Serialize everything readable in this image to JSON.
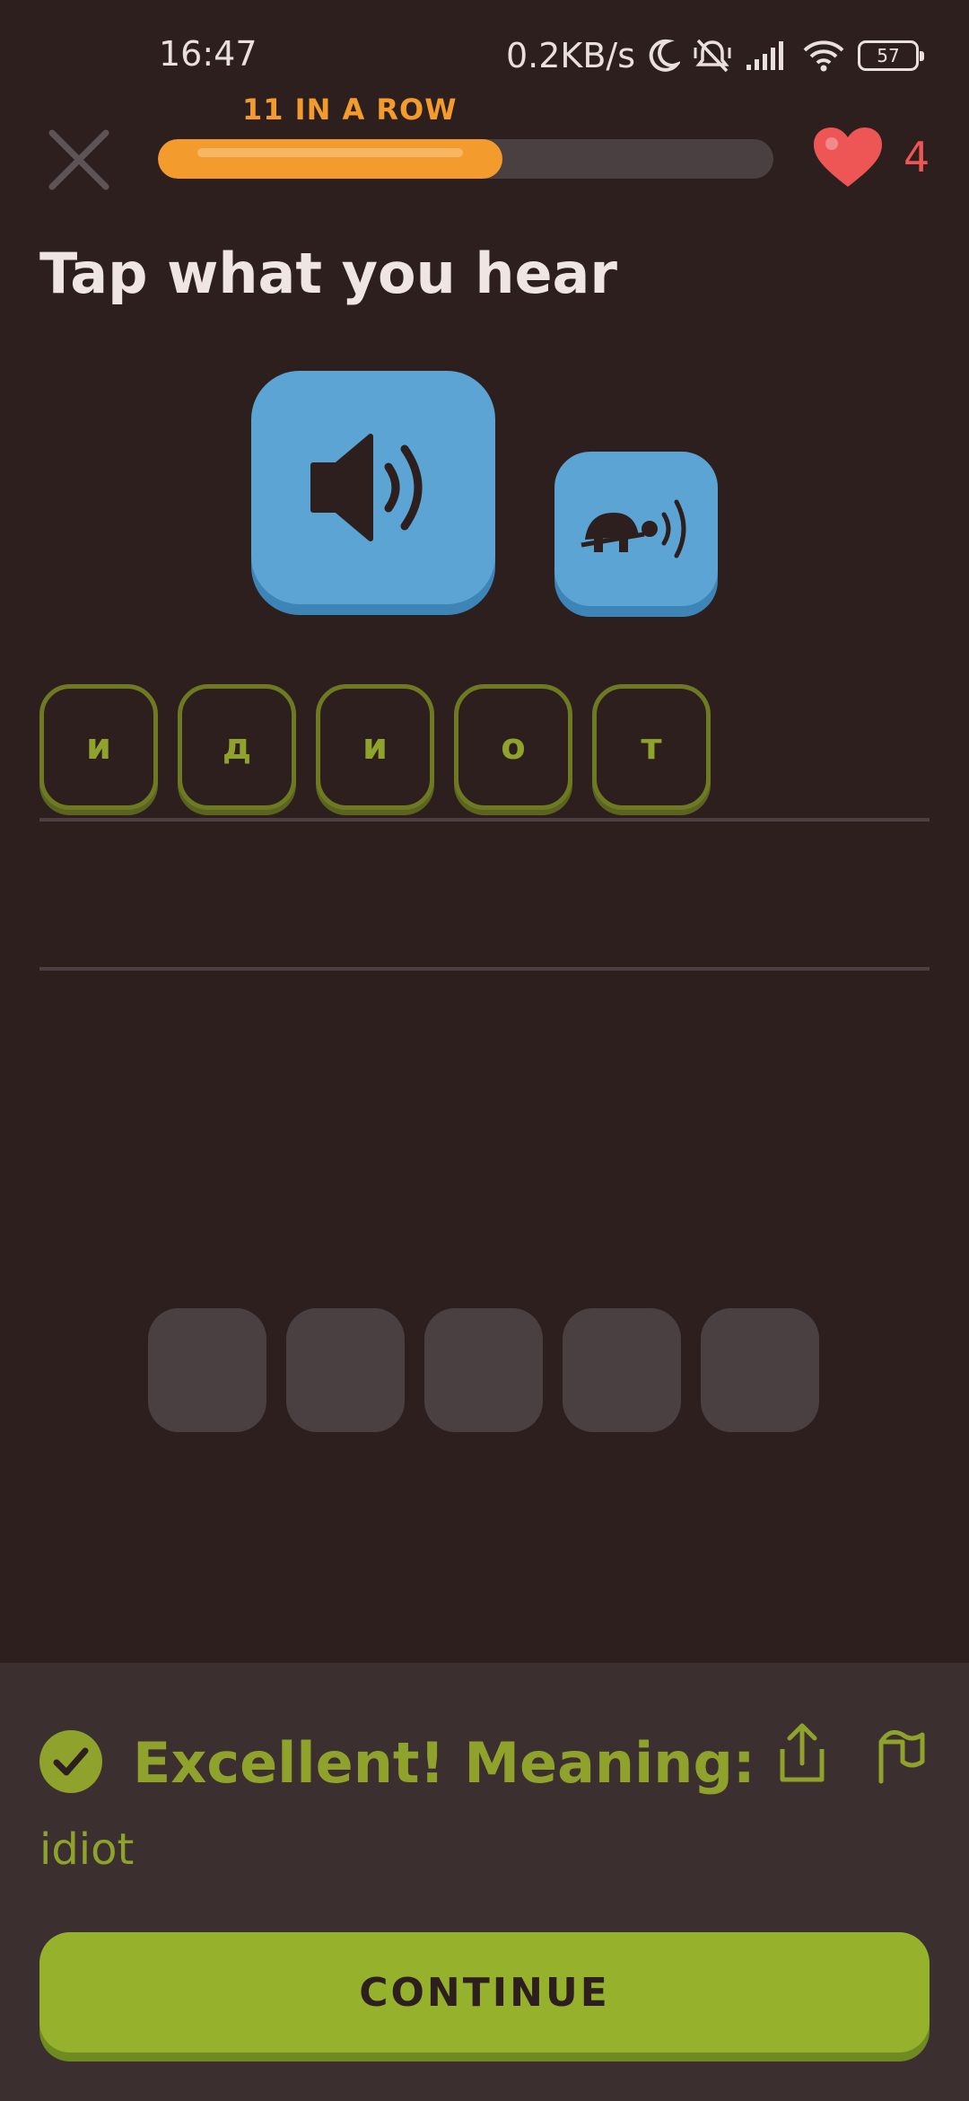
{
  "status_bar": {
    "time": "16:47",
    "net_speed": "0.2KB/s",
    "battery": "57"
  },
  "header": {
    "streak_label": "11 IN A ROW",
    "progress_fraction": 0.56,
    "hearts": "4",
    "colors": {
      "progress": "#f39b2d",
      "heart": "#ee5555"
    }
  },
  "exercise": {
    "prompt": "Tap what you hear",
    "answer_tiles": [
      "и",
      "д",
      "и",
      "о",
      "т"
    ],
    "bank_empty_slots": 5
  },
  "feedback": {
    "title": "Excellent! Meaning:",
    "meaning": "idiot",
    "continue_label": "CONTINUE",
    "accent_color": "#8fa22c"
  },
  "icons": {
    "close": "close-icon",
    "heart": "heart-icon",
    "speaker": "speaker-icon",
    "slow_speaker": "turtle-speaker-icon",
    "check": "check-icon",
    "share": "share-icon",
    "flag": "flag-icon"
  }
}
